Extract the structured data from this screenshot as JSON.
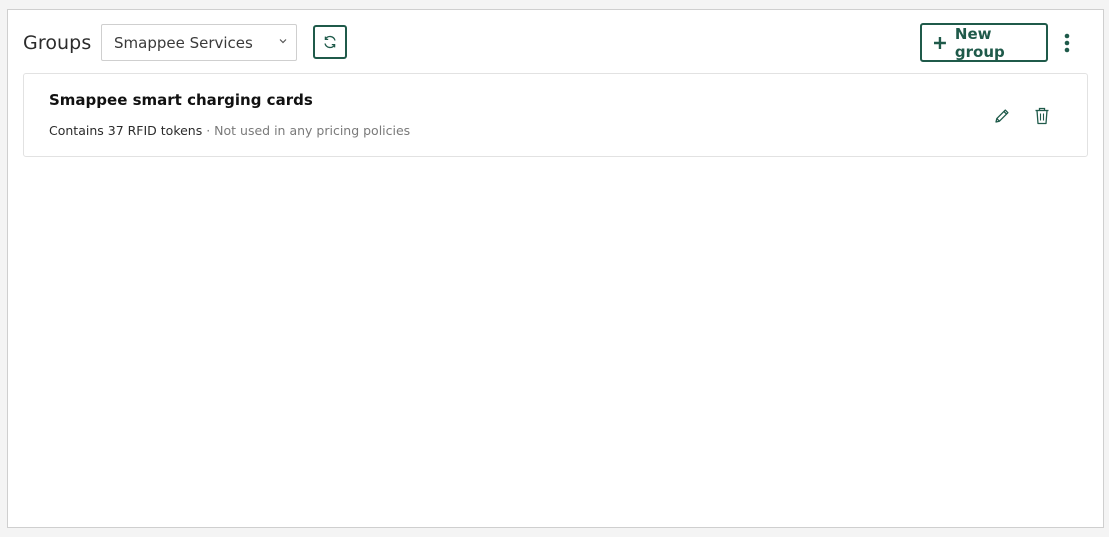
{
  "header": {
    "title": "Groups",
    "select_value": "Smappee Services",
    "new_group_label": "New group"
  },
  "icons": {
    "refresh": "refresh-icon",
    "plus": "plus-icon",
    "more": "more-vertical-icon",
    "edit": "pencil-icon",
    "delete": "trash-icon",
    "dropdown": "chevron-down-icon"
  },
  "colors": {
    "accent": "#1f5a4a",
    "border": "#cfcfcf",
    "muted_text": "#7a7a7a"
  },
  "groups": [
    {
      "name": "Smappee smart charging cards",
      "count_text": "Contains 37 RFID tokens",
      "separator": " · ",
      "policy_text": "Not used in any pricing policies"
    }
  ]
}
